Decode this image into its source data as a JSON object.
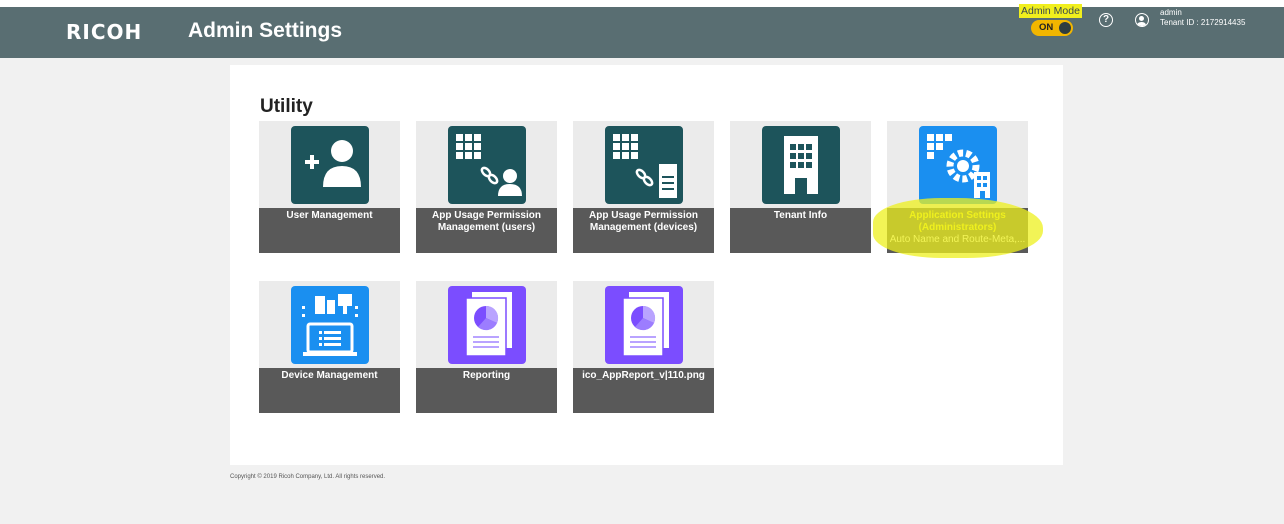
{
  "header": {
    "logo": "RICOH",
    "title": "Admin Settings",
    "admin_mode_label": "Admin Mode",
    "toggle_state": "ON",
    "help_glyph": "?",
    "user_name": "admin",
    "tenant_id": "Tenant ID : 2172914435"
  },
  "main": {
    "section_title": "Utility",
    "tiles": [
      {
        "label": "User Management",
        "sub": "",
        "icon": "add-user-icon"
      },
      {
        "label": "App Usage Permission Management (users)",
        "sub": "",
        "icon": "app-permission-users-icon"
      },
      {
        "label": "App Usage Permission Management (devices)",
        "sub": "",
        "icon": "app-permission-devices-icon"
      },
      {
        "label": "Tenant Info",
        "sub": "",
        "icon": "building-icon"
      },
      {
        "label": "Application Settings (Administrators)",
        "sub": "Auto Name and Route-Meta,...",
        "icon": "app-settings-gear-icon"
      },
      {
        "label": "Device Management",
        "sub": "",
        "icon": "device-management-icon"
      },
      {
        "label": "Reporting",
        "sub": "",
        "icon": "report-pie-icon"
      },
      {
        "label": "ico_AppReport_v|110.png",
        "sub": "",
        "icon": "report-pie-icon"
      }
    ]
  },
  "footer": {
    "copyright": "Copyright © 2019 Ricoh Company, Ltd. All rights reserved."
  },
  "colors": {
    "header_bg": "#596e72",
    "tile_teal": "#1d545b",
    "tile_blue": "#1a8ff0",
    "tile_purple": "#7b4dff",
    "highlight": "#f1ef1d",
    "toggle_on": "#f2b600"
  }
}
